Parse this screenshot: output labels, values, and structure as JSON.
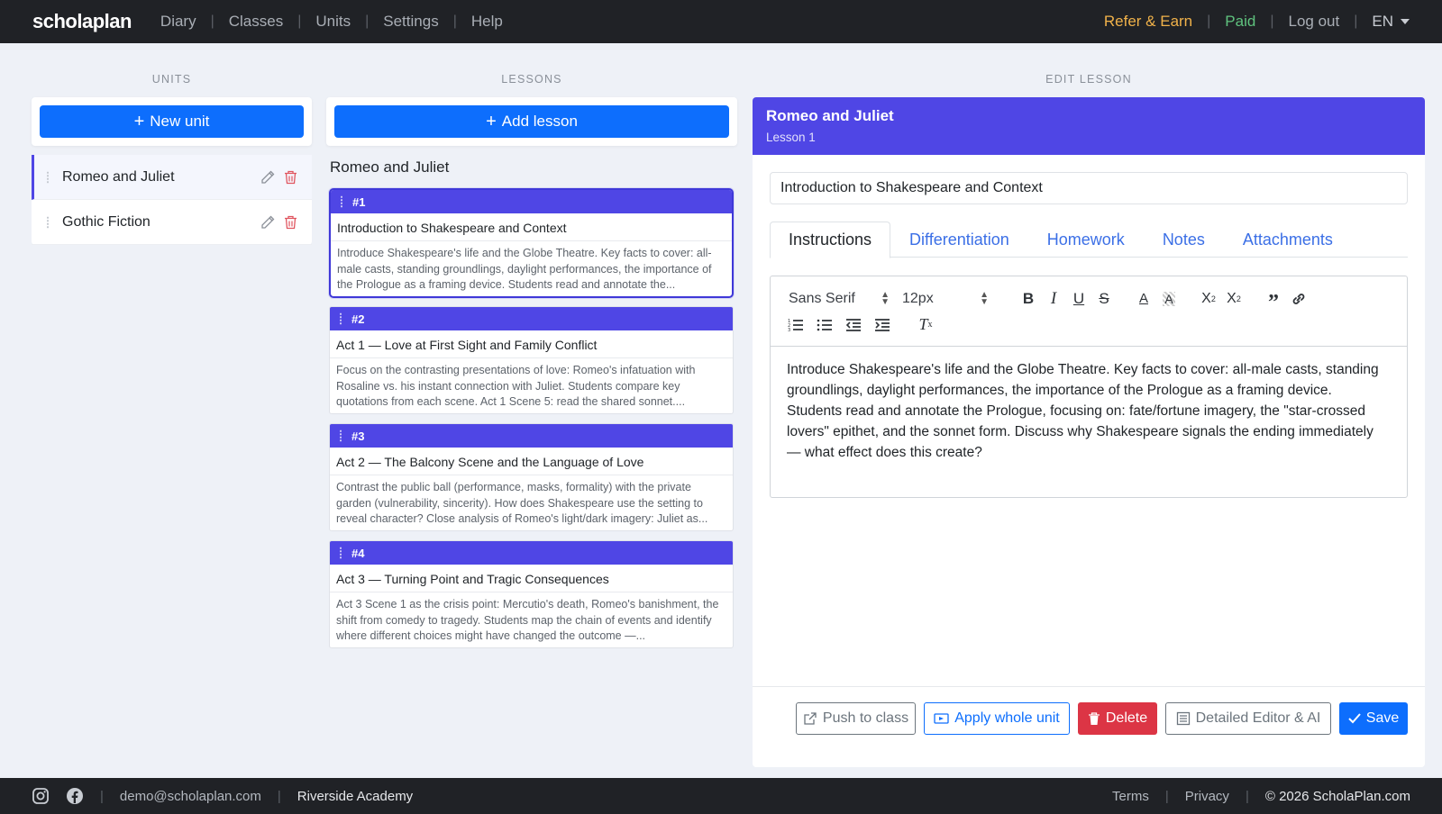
{
  "nav": {
    "brand": "scholaplan",
    "links": [
      "Diary",
      "Classes",
      "Units",
      "Settings",
      "Help"
    ],
    "refer": "Refer & Earn",
    "paid": "Paid",
    "logout": "Log out",
    "lang": "EN"
  },
  "headings": {
    "units": "UNITS",
    "lessons": "LESSONS",
    "edit": "EDIT LESSON"
  },
  "units": {
    "new_button": "New unit",
    "items": [
      {
        "name": "Romeo and Juliet"
      },
      {
        "name": "Gothic Fiction"
      }
    ]
  },
  "lessons": {
    "add_button": "Add lesson",
    "unit_title": "Romeo and Juliet",
    "items": [
      {
        "num": "#1",
        "title": "Introduction to Shakespeare and Context",
        "desc": "Introduce Shakespeare's life and the Globe Theatre. Key facts to cover: all-male casts, standing groundlings, daylight performances, the importance of the Prologue as a framing device. Students read and annotate the..."
      },
      {
        "num": "#2",
        "title": "Act 1 — Love at First Sight and Family Conflict",
        "desc": "Focus on the contrasting presentations of love: Romeo's infatuation with Rosaline vs. his instant connection with Juliet. Students compare key quotations from each scene. Act 1 Scene 5: read the shared sonnet...."
      },
      {
        "num": "#3",
        "title": "Act 2 — The Balcony Scene and the Language of Love",
        "desc": "Contrast the public ball (performance, masks, formality) with the private garden (vulnerability, sincerity). How does Shakespeare use the setting to reveal character? Close analysis of Romeo's light/dark imagery: Juliet as..."
      },
      {
        "num": "#4",
        "title": "Act 3 — Turning Point and Tragic Consequences",
        "desc": "Act 3 Scene 1 as the crisis point: Mercutio's death, Romeo's banishment, the shift from comedy to tragedy. Students map the chain of events and identify where different choices might have changed the outcome —..."
      }
    ]
  },
  "edit": {
    "title": "Romeo and Juliet",
    "subtitle": "Lesson 1",
    "lesson_title_value": "Introduction to Shakespeare and Context",
    "tabs": [
      "Instructions",
      "Differentiation",
      "Homework",
      "Notes",
      "Attachments"
    ],
    "toolbar": {
      "font": "Sans Serif",
      "size": "12px"
    },
    "body_p1": "Introduce Shakespeare's life and the Globe Theatre. Key facts to cover: all-male casts, standing groundlings, daylight performances, the importance of the Prologue as a framing device.",
    "body_p2": "Students read and annotate the Prologue, focusing on: fate/fortune imagery, the \"star-crossed lovers\" epithet, and the sonnet form. Discuss why Shakespeare signals the ending immediately — what effect does this create?",
    "buttons": {
      "push": "Push to class",
      "apply": "Apply whole unit",
      "delete": "Delete",
      "detailed": "Detailed Editor & AI",
      "save": "Save"
    }
  },
  "footer": {
    "email": "demo@scholaplan.com",
    "school": "Riverside Academy",
    "terms": "Terms",
    "privacy": "Privacy",
    "copyright": "© 2026 ScholaPlan.com"
  },
  "colors": {
    "accent": "#4f46e5",
    "primary": "#0d6efd",
    "danger": "#dc3545",
    "dark": "#202226"
  }
}
